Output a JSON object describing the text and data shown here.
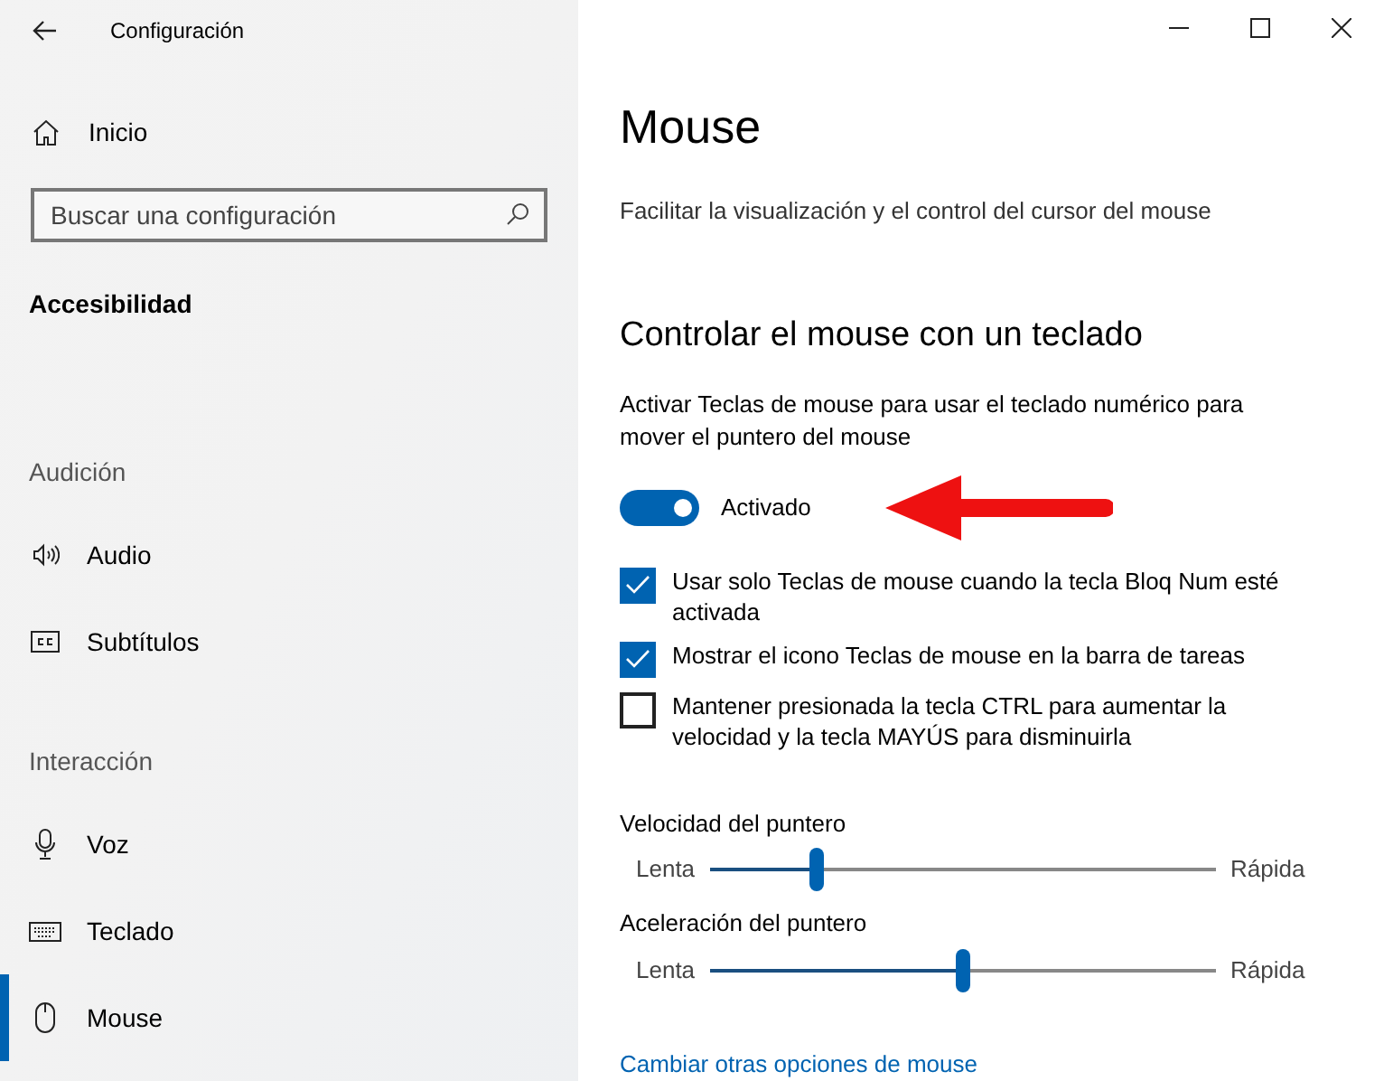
{
  "window": {
    "title": "Configuración"
  },
  "sidebar": {
    "home": "Inicio",
    "search": {
      "placeholder": "Buscar una configuración"
    },
    "category": "Accesibilidad",
    "groups": [
      {
        "label": "Audición",
        "items": [
          {
            "label": "Audio",
            "selected": false
          },
          {
            "label": "Subtítulos",
            "selected": false
          }
        ]
      },
      {
        "label": "Interacción",
        "items": [
          {
            "label": "Voz",
            "selected": false
          },
          {
            "label": "Teclado",
            "selected": false
          },
          {
            "label": "Mouse",
            "selected": true
          }
        ]
      }
    ]
  },
  "page": {
    "title": "Mouse",
    "subtitle": "Facilitar la visualización y el control del cursor del mouse",
    "section_title": "Controlar el mouse con un teclado",
    "toggle": {
      "label": "Activar Teclas de mouse para usar el teclado numérico para mover el puntero del mouse",
      "on": true,
      "state_text": "Activado"
    },
    "checkboxes": [
      {
        "label": "Usar solo Teclas de mouse cuando la tecla Bloq Num esté activada",
        "checked": true
      },
      {
        "label": "Mostrar el icono Teclas de mouse en la barra de tareas",
        "checked": true
      },
      {
        "label": "Mantener presionada la tecla CTRL para aumentar la velocidad y la tecla MAYÚS para disminuirla",
        "checked": false
      }
    ],
    "sliders": [
      {
        "label": "Velocidad del puntero",
        "min_label": "Lenta",
        "max_label": "Rápida",
        "level": 0.21
      },
      {
        "label": "Aceleración del puntero",
        "min_label": "Lenta",
        "max_label": "Rápida",
        "level": 0.5
      }
    ],
    "link": "Cambiar otras opciones de mouse"
  }
}
